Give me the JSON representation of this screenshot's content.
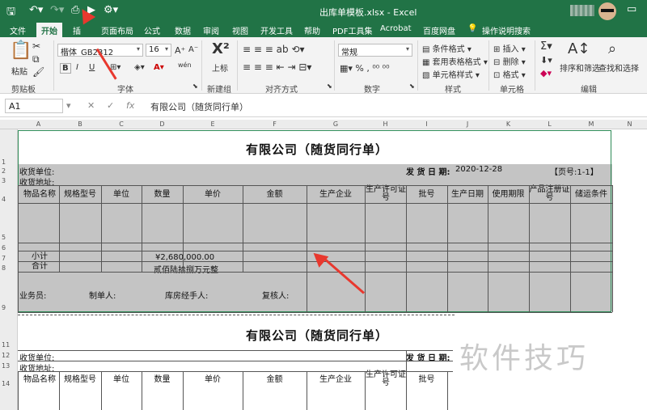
{
  "window": {
    "title": "出库单模板.xlsx  -  Excel"
  },
  "tabs": [
    {
      "label": "文件"
    },
    {
      "label": "开始"
    },
    {
      "label": "插"
    },
    {
      "label": "页面布局"
    },
    {
      "label": "公式"
    },
    {
      "label": "数据"
    },
    {
      "label": "审阅"
    },
    {
      "label": "视图"
    },
    {
      "label": "开发工具"
    },
    {
      "label": "帮助"
    },
    {
      "label": "PDF工具集"
    },
    {
      "label": "Acrobat"
    },
    {
      "label": "百度网盘"
    },
    {
      "label": "操作说明搜索"
    }
  ],
  "ribbon": {
    "paste": "粘贴",
    "clipboard_group": "剪贴板",
    "font_name": "楷体_GB2312",
    "font_size": "16",
    "font_group": "字体",
    "bold": "B",
    "italic": "I",
    "underline": "U",
    "superscript_label": "上标",
    "new_group": "新建组",
    "align_group": "对齐方式",
    "number_format": "常规",
    "number_group": "数字",
    "cond_format": "条件格式",
    "table_format": "套用表格格式",
    "cell_style": "单元格样式",
    "style_group": "样式",
    "insert": "插入",
    "delete": "删除",
    "format": "格式",
    "cells_group": "单元格",
    "sort_filter": "排序和筛选",
    "find_select": "查找和选择",
    "edit_group": "编辑",
    "wen": "wén"
  },
  "formula_bar": {
    "name_box": "A1",
    "fx": "fx",
    "content": "有限公司（随货同行单）"
  },
  "columns": [
    "A",
    "B",
    "C",
    "D",
    "E",
    "F",
    "G",
    "H",
    "I",
    "J",
    "K",
    "L",
    "M",
    "N"
  ],
  "rows": [
    "1",
    "2",
    "3",
    "4",
    "5",
    "6",
    "7",
    "8",
    "9",
    "11",
    "12",
    "13",
    "14"
  ],
  "form": {
    "title": "有限公司（随货同行单）",
    "receiver_unit": "收货单位:",
    "receiver_addr": "收货地址:",
    "ship_date_label": "发 货 日 期:",
    "ship_date": "2020-12-28",
    "page_no": "【页号:1-1】",
    "headers": [
      "物品名称",
      "规格型号",
      "单位",
      "数量",
      "单价",
      "金额",
      "生产企业",
      "生产许可证号",
      "批号",
      "生产日期",
      "使用期限",
      "产品注册证号",
      "储运条件"
    ],
    "subtotal_label": "小计",
    "subtotal_value": "¥2,680,000.00",
    "total_label": "合计",
    "total_value": "贰佰陆拾捌万元整",
    "salesman": "业务员:",
    "maker": "制单人:",
    "warehouse": "库房经手人:",
    "reviewer": "复核人:"
  },
  "form2": {
    "title": "有限公司（随货同行单）",
    "receiver_unit": "收货单位:",
    "receiver_addr": "收货地址:",
    "ship_date_label": "发 货 日 期:",
    "headers": [
      "物品名称",
      "规格型号",
      "单位",
      "数量",
      "单价",
      "金额",
      "生产企业",
      "生产许可证号",
      "批号"
    ]
  },
  "watermark": "软件技巧"
}
